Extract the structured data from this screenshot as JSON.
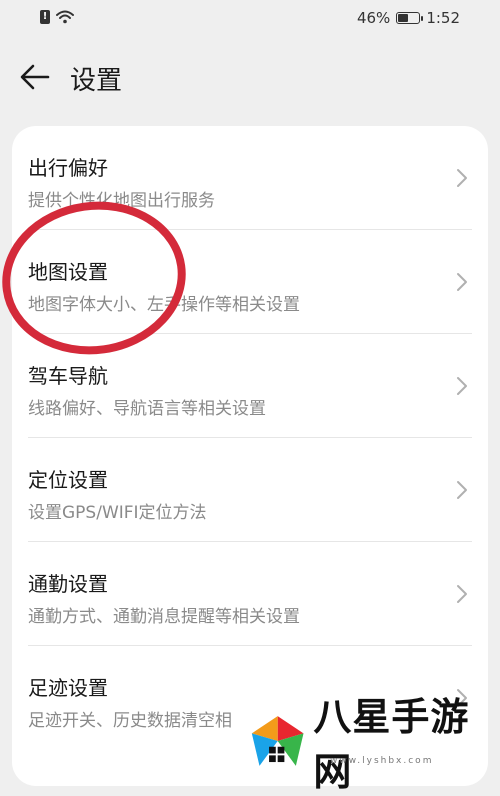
{
  "status_bar": {
    "battery_percent": "46%",
    "battery_level": 0.46,
    "time": "1:52",
    "icons": [
      "sim-alert-icon",
      "wifi-icon",
      "battery-icon"
    ]
  },
  "header": {
    "title": "设置",
    "back_icon": "arrow-left-icon"
  },
  "settings": {
    "items": [
      {
        "title": "出行偏好",
        "subtitle": "提供个性化地图出行服务"
      },
      {
        "title": "地图设置",
        "subtitle": "地图字体大小、左手操作等相关设置"
      },
      {
        "title": "驾车导航",
        "subtitle": "线路偏好、导航语言等相关设置"
      },
      {
        "title": "定位设置",
        "subtitle": "设置GPS/WIFI定位方法"
      },
      {
        "title": "通勤设置",
        "subtitle": "通勤方式、通勤消息提醒等相关设置"
      },
      {
        "title": "足迹设置",
        "subtitle": "足迹开关、历史数据清空相"
      }
    ]
  },
  "annotation": {
    "color": "#d42a3a",
    "target": "地图设置"
  },
  "watermark": {
    "text": "八星手游网",
    "url": "www.lyshbx.com"
  },
  "colors": {
    "background": "#efefef",
    "card": "#ffffff",
    "primary_text": "#1a1a1a",
    "secondary_text": "#8a8a8a",
    "annotation_red": "#d42a3a"
  }
}
